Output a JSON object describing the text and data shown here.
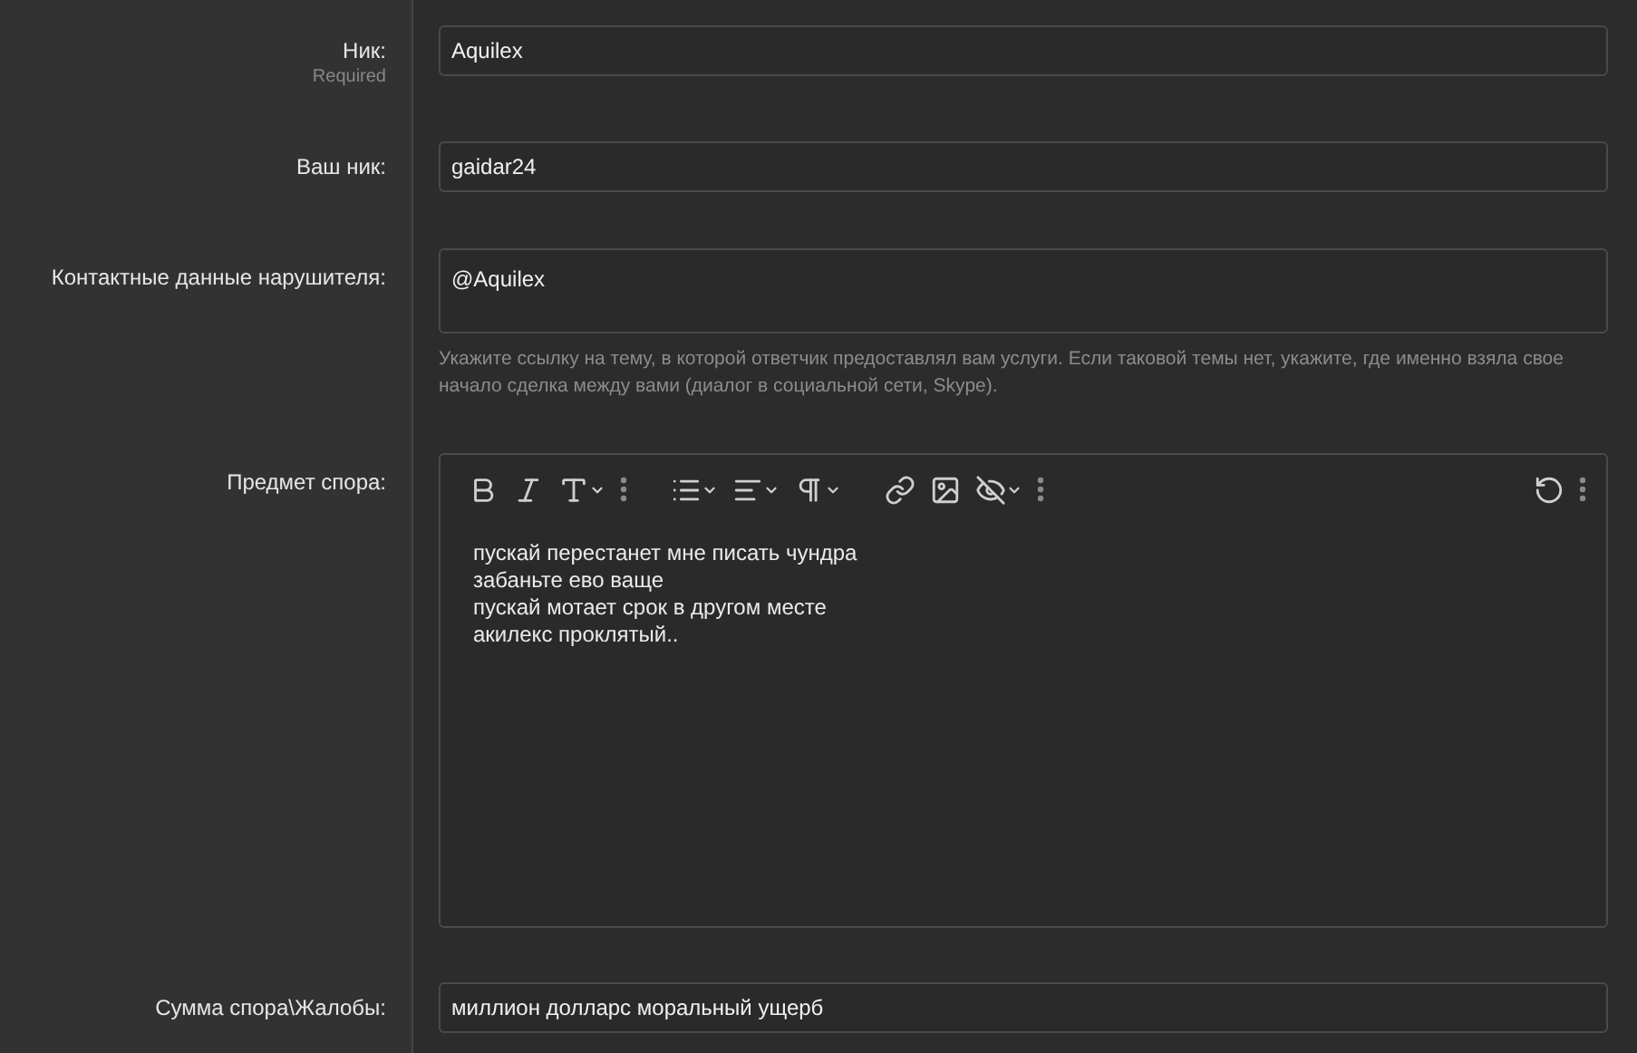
{
  "fields": [
    {
      "kind": "input",
      "label": "Ник:",
      "required_note": "Required",
      "value": "Aquilex"
    },
    {
      "kind": "input",
      "label": "Ваш ник:",
      "value": "gaidar24"
    },
    {
      "kind": "textarea",
      "label": "Контактные данные нарушителя:",
      "value": "@Aquilex",
      "hint": "Укажите ссылку на тему, в которой ответчик предоставлял вам услуги. Если таковой темы нет, укажите, где именно взяла свое начало сделка между вами (диалог в социальной сети, Skype)."
    },
    {
      "kind": "editor",
      "label": "Предмет спора:",
      "lines": [
        "пускай перестанет мне писать чундра",
        "забаньте ево ваще",
        "пускай мотает срок в другом месте",
        "акилекс проклятый.."
      ]
    },
    {
      "kind": "input",
      "label": "Сумма спора\\Жалобы:",
      "value": "миллион долларс моральный ущерб"
    }
  ]
}
